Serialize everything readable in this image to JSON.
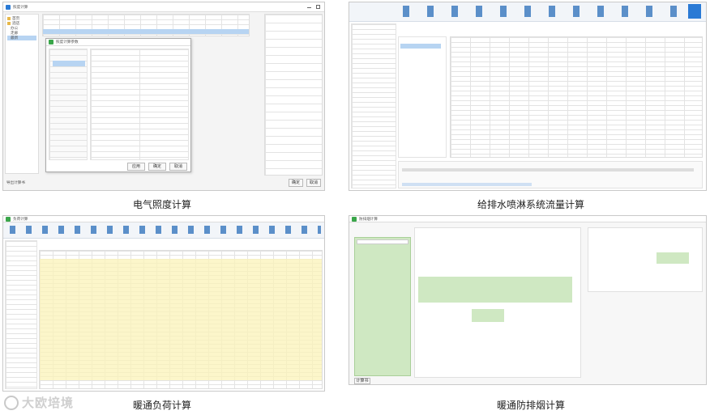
{
  "captions": {
    "electric": "电气照度计算",
    "water": "给排水喷淋系统流量计算",
    "hvac_load": "暖通负荷计算",
    "hvac_smoke": "暖通防排烟计算"
  },
  "watermark": {
    "text": "大欧培境"
  },
  "electric": {
    "window_title": "照度计算",
    "tree_items": [
      "首页",
      "酒店",
      "办公",
      "走廊",
      "最新"
    ],
    "sub_dialog_title": "照度计算参数",
    "buttons": {
      "ok": "确定",
      "cancel": "取消",
      "apply": "应用"
    },
    "footer_left": "导出计算书",
    "footer_right_ok": "确定",
    "footer_right_cancel": "取消"
  },
  "hvac_load": {
    "window_title": "负荷计算"
  },
  "hvac_smoke": {
    "window_title": "防排烟计算",
    "footer_btn": "计算书"
  },
  "colors": {
    "accent_blue": "#2a7ad5",
    "green_panel": "#cfe8c2",
    "highlight_yellow": "#fbf3b8",
    "selected_blue": "#b7d4f2"
  }
}
